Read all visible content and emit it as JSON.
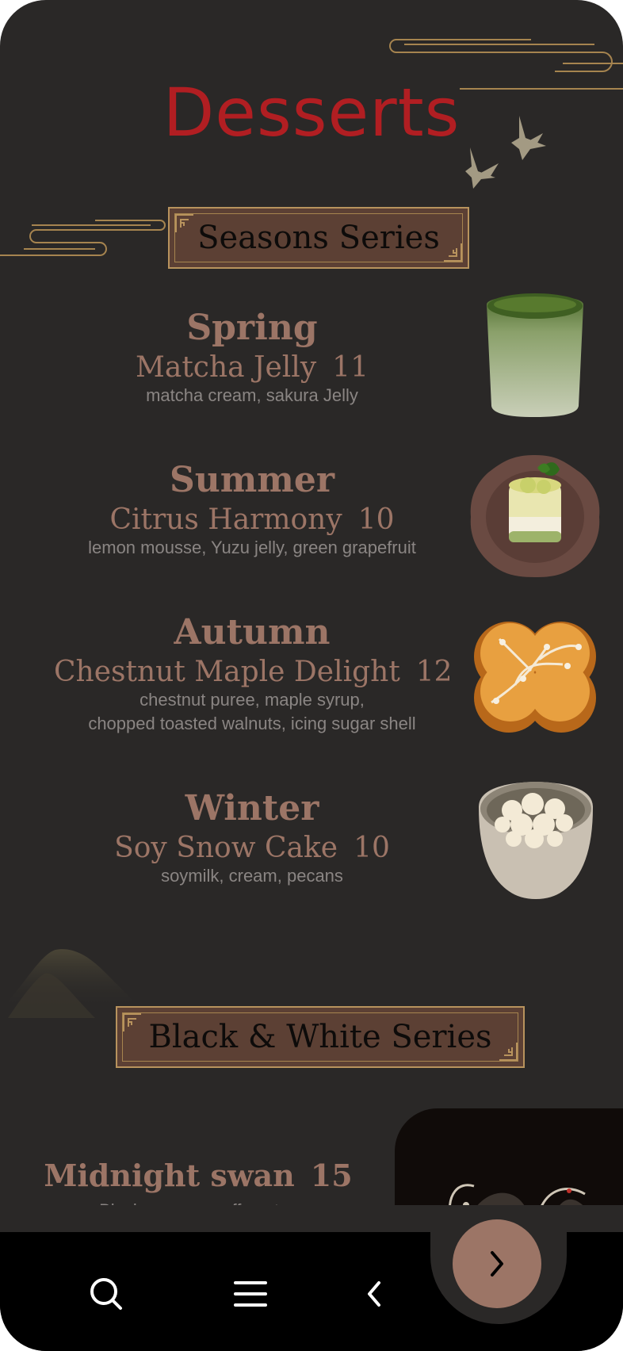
{
  "page_title": "Desserts",
  "series": [
    {
      "name": "Seasons Series",
      "items": [
        {
          "season": "Spring",
          "dish": "Matcha Jelly",
          "price": "11",
          "ingredients": [
            "matcha cream, sakura Jelly"
          ],
          "image": "matcha-jelly-photo"
        },
        {
          "season": "Summer",
          "dish": "Citrus Harmony",
          "price": "10",
          "ingredients": [
            "lemon mousse, Yuzu jelly, green grapefruit"
          ],
          "image": "citrus-harmony-photo"
        },
        {
          "season": "Autumn",
          "dish": "Chestnut Maple Delight",
          "price": "12",
          "ingredients": [
            "chestnut puree, maple syrup,",
            "chopped toasted walnuts, icing sugar shell"
          ],
          "image": "chestnut-maple-photo"
        },
        {
          "season": "Winter",
          "dish": "Soy Snow Cake",
          "price": "10",
          "ingredients": [
            "soymilk, cream, pecans"
          ],
          "image": "soy-snow-cake-photo"
        }
      ]
    },
    {
      "name": "Black & White Series",
      "items": [
        {
          "dish": "Midnight swan",
          "price": "15",
          "ingredients": [
            "Black sesame puff pastry,"
          ],
          "image": "midnight-swan-photo"
        }
      ]
    }
  ],
  "nav": {
    "icons": [
      "search-icon",
      "menu-icon",
      "back-icon"
    ],
    "fab_icon": "forward-icon"
  },
  "colors": {
    "background": "#2a2827",
    "title": "#b11e22",
    "accent": "#9c7566",
    "banner": "#5c4034",
    "banner_border": "#b8935d",
    "navbar": "#000000"
  }
}
